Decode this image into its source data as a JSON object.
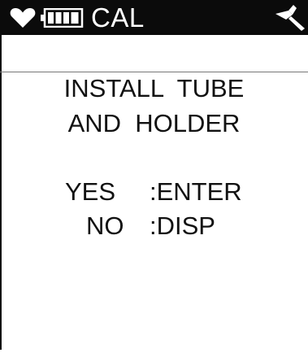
{
  "status_bar": {
    "mode_label": "CAL",
    "icons": [
      "heart-icon",
      "battery-icon",
      "signal-icon"
    ],
    "background_color": "#0b0b0b",
    "text_color": "#ffffff"
  },
  "message": {
    "line_1": "INSTALL  TUBE",
    "line_2": "AND  HOLDER"
  },
  "options": [
    {
      "key": "YES",
      "action": ":ENTER"
    },
    {
      "key": "NO",
      "action": ":DISP"
    }
  ]
}
